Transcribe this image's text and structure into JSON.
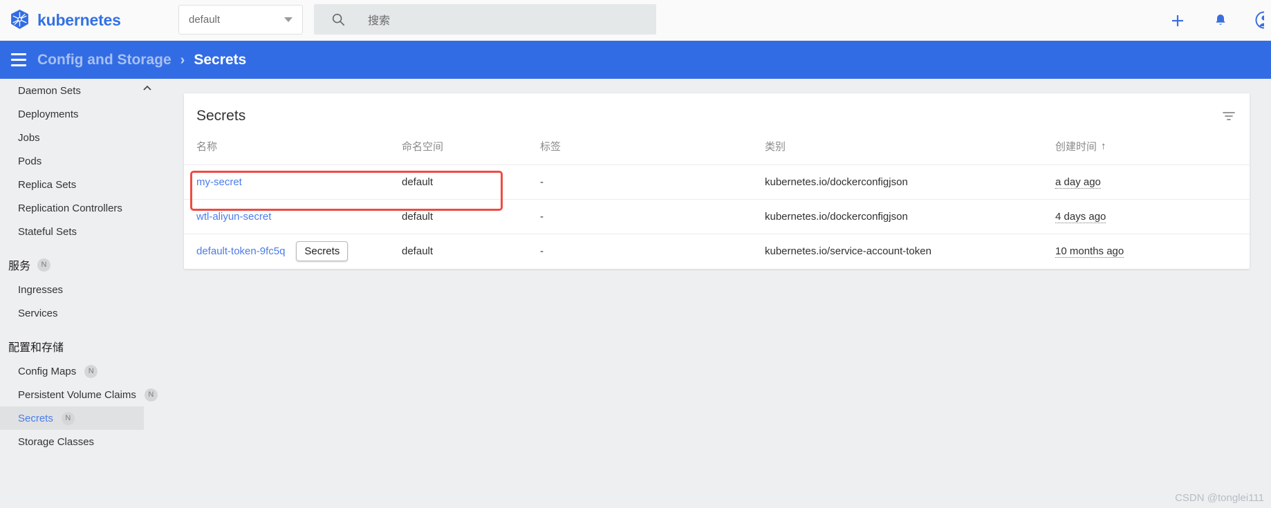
{
  "topbar": {
    "brand": "kubernetes",
    "logo_icon": "kubernetes-helm-icon",
    "namespace_select": {
      "value": "default",
      "caret_icon": "chevron-down-icon"
    },
    "search": {
      "icon": "search-icon",
      "placeholder": "搜索",
      "value": ""
    },
    "actions": [
      {
        "name": "create-button",
        "icon": "plus-icon"
      },
      {
        "name": "notifications-button",
        "icon": "bell-icon"
      },
      {
        "name": "account-button",
        "icon": "account-circle-icon"
      }
    ],
    "accent_color": "#326ce5"
  },
  "breadcrumb": {
    "menu_icon": "hamburger-menu-icon",
    "parent": "Config and Storage",
    "separator": "›",
    "current": "Secrets",
    "bar_color": "#326ce5"
  },
  "sidebar": {
    "collapse_icon": "chevron-up-icon",
    "items": [
      {
        "label": "Daemon Sets",
        "type": "item",
        "selected": false,
        "badge": ""
      },
      {
        "label": "Deployments",
        "type": "item",
        "selected": false,
        "badge": ""
      },
      {
        "label": "Jobs",
        "type": "item",
        "selected": false,
        "badge": ""
      },
      {
        "label": "Pods",
        "type": "item",
        "selected": false,
        "badge": ""
      },
      {
        "label": "Replica Sets",
        "type": "item",
        "selected": false,
        "badge": ""
      },
      {
        "label": "Replication Controllers",
        "type": "item",
        "selected": false,
        "badge": ""
      },
      {
        "label": "Stateful Sets",
        "type": "item",
        "selected": false,
        "badge": ""
      },
      {
        "label": "服务",
        "type": "group",
        "selected": false,
        "badge": "N"
      },
      {
        "label": "Ingresses",
        "type": "item",
        "selected": false,
        "badge": ""
      },
      {
        "label": "Services",
        "type": "item",
        "selected": false,
        "badge": ""
      },
      {
        "label": "配置和存储",
        "type": "group",
        "selected": false,
        "badge": ""
      },
      {
        "label": "Config Maps",
        "type": "item",
        "selected": false,
        "badge": "N"
      },
      {
        "label": "Persistent Volume Claims",
        "type": "item",
        "selected": false,
        "badge": "N"
      },
      {
        "label": "Secrets",
        "type": "item",
        "selected": true,
        "badge": "N"
      },
      {
        "label": "Storage Classes",
        "type": "item",
        "selected": false,
        "badge": ""
      }
    ]
  },
  "card": {
    "title": "Secrets",
    "filter_icon": "filter-list-icon",
    "columns": [
      {
        "key": "name",
        "label": "名称",
        "sorted": false,
        "sort_arrow": ""
      },
      {
        "key": "namespace",
        "label": "命名空间",
        "sorted": false,
        "sort_arrow": ""
      },
      {
        "key": "labels",
        "label": "标签",
        "sorted": false,
        "sort_arrow": ""
      },
      {
        "key": "type",
        "label": "类别",
        "sorted": false,
        "sort_arrow": ""
      },
      {
        "key": "created",
        "label": "创建时间",
        "sorted": true,
        "sort_arrow": "↑"
      }
    ],
    "rows": [
      {
        "name": "my-secret",
        "namespace": "default",
        "labels": "-",
        "type": "kubernetes.io/dockerconfigjson",
        "created": "a day ago",
        "tooltip": "",
        "highlighted": true
      },
      {
        "name": "wtl-aliyun-secret",
        "namespace": "default",
        "labels": "-",
        "type": "kubernetes.io/dockerconfigjson",
        "created": "4 days ago",
        "tooltip": "",
        "highlighted": false
      },
      {
        "name": "default-token-9fc5q",
        "namespace": "default",
        "labels": "-",
        "type": "kubernetes.io/service-account-token",
        "created": "10 months ago",
        "tooltip": "Secrets",
        "highlighted": false
      }
    ],
    "annotation_color": "#f04a42"
  },
  "watermark": "CSDN @tonglei111"
}
